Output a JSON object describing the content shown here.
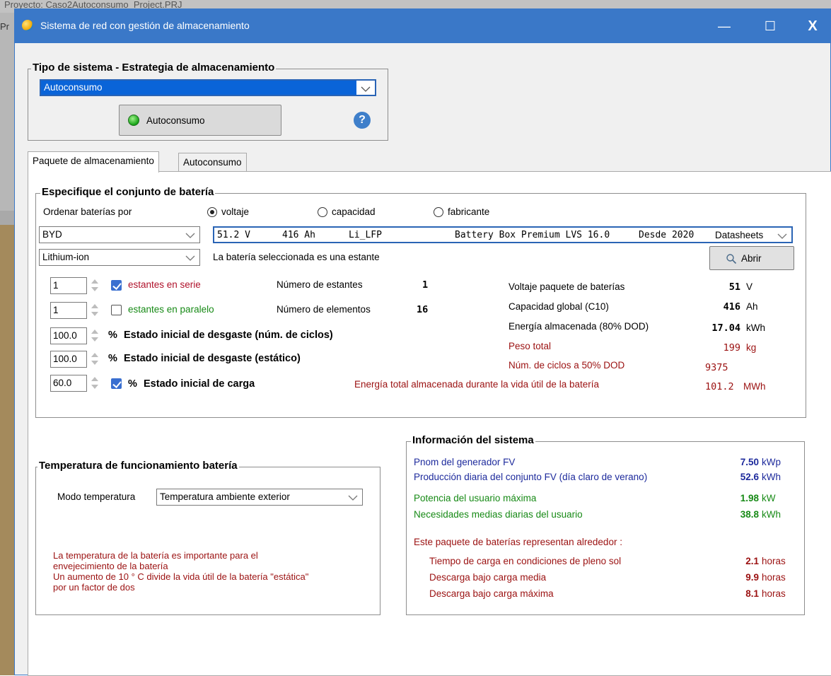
{
  "background": {
    "project_title": "Proyecto:  Caso2Autoconsumo_Project.PRJ",
    "left_label": "Pr"
  },
  "window": {
    "title": "Sistema de red con gestión de almacenamiento",
    "minimize": "—",
    "maximize": "☐",
    "close": "X"
  },
  "system_type": {
    "group_title": "Tipo de sistema - Estrategia de almacenamiento",
    "combo_value": "Autoconsumo",
    "button_label": "Autoconsumo",
    "help": "?"
  },
  "tabs": [
    {
      "label": "Paquete de almacenamiento",
      "active": true
    },
    {
      "label": "Autoconsumo",
      "active": false
    }
  ],
  "battery_set": {
    "group_title": "Especifique el conjunto de batería",
    "sort_label": "Ordenar baterías por",
    "sort_options": [
      "voltaje",
      "capacidad",
      "fabricante"
    ],
    "sort_selected": "voltaje",
    "manufacturer": "BYD",
    "battery": {
      "voltage": "51.2 V",
      "capacity": "416 Ah",
      "tech": "Li_LFP",
      "model": "Battery Box Premium LVS 16.0",
      "since": "Desde 2020",
      "source": "Datasheets"
    },
    "technology": "Lithium-ion",
    "selected_note": "La batería seleccionada es una estante",
    "open_button": "Abrir"
  },
  "config": {
    "series_value": "1",
    "series_label": "estantes en serie",
    "series_checked": true,
    "parallel_value": "1",
    "parallel_label": "estantes en paralelo",
    "parallel_checked": false,
    "num_racks_label": "Número de estantes",
    "num_racks_value": "1",
    "num_elements_label": "Número de elementos",
    "num_elements_value": "16",
    "wear_cycles_value": "100.0",
    "wear_cycles_label": "Estado inicial de desgaste (núm. de ciclos)",
    "wear_static_value": "100.0",
    "wear_static_label": "Estado inicial de desgaste (estático)",
    "charge_value": "60.0",
    "charge_label": "Estado inicial de carga",
    "charge_checked": true,
    "percent": "%"
  },
  "pack_stats": [
    {
      "label": "Voltaje paquete de baterías",
      "value": "51",
      "unit": "V"
    },
    {
      "label": "Capacidad global (C10)",
      "value": "416",
      "unit": "Ah"
    },
    {
      "label": "Energía almacenada (80% DOD)",
      "value": "17.04",
      "unit": "kWh"
    },
    {
      "label": "Peso total",
      "value": "199",
      "unit": "kg"
    },
    {
      "label": "Núm. de ciclos a 50% DOD",
      "value": "9375",
      "unit": ""
    },
    {
      "label": "Energía total almacenada durante la vida útil de la batería",
      "value": "101.2",
      "unit": "MWh"
    }
  ],
  "temperature": {
    "group_title": "Temperatura de funcionamiento batería",
    "mode_label": "Modo temperatura",
    "mode_value": "Temperatura ambiente exterior",
    "note_lines": [
      "La temperatura de la batería es importante para el",
      "envejecimiento de la batería",
      "Un aumento de 10 ° C divide la vida útil de la batería \"estática\"",
      "por un factor de dos"
    ]
  },
  "system_info": {
    "group_title": "Información del sistema",
    "rows": [
      {
        "label": "Pnom del generador FV",
        "value": "7.50",
        "unit": "kWp"
      },
      {
        "label": "Producción diaria del conjunto FV (día claro de verano)",
        "value": "52.6",
        "unit": "kWh"
      },
      {
        "label": "Potencia del usuario máxima",
        "value": "1.98",
        "unit": "kW"
      },
      {
        "label": "Necesidades medias diarias del usuario",
        "value": "38.8",
        "unit": "kWh"
      }
    ],
    "represent_label": "Este paquete de baterías representan alrededor :",
    "represent_rows": [
      {
        "label": "Tiempo de carga en condiciones de pleno sol",
        "value": "2.1",
        "unit": "horas"
      },
      {
        "label": "Descarga bajo carga media",
        "value": "9.9",
        "unit": "horas"
      },
      {
        "label": "Descarga bajo carga máxima",
        "value": "8.1",
        "unit": "horas"
      }
    ]
  },
  "colors": {
    "title_bar": "#3a78c8",
    "selection": "#0a64d8",
    "red_text": "#b0122b",
    "green_text": "#178a16",
    "blue_text": "#1d2a9c"
  }
}
